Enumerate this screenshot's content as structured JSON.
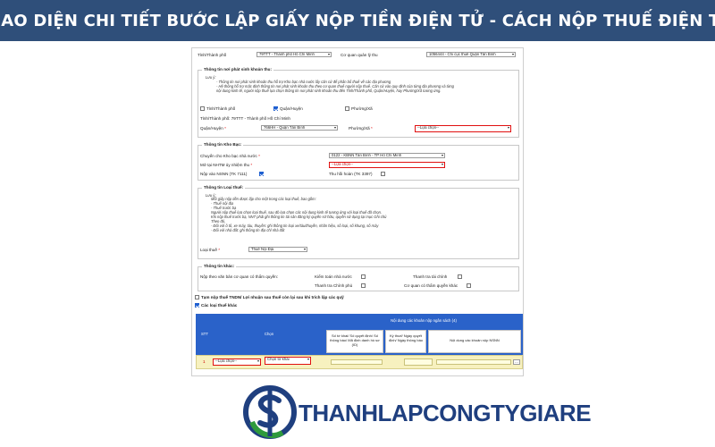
{
  "banner": {
    "title": "GIAO DIỆN CHI TIẾT BƯỚC LẬP GIẤY NỘP TIỀN ĐIỆN TỬ - CÁCH NỘP THUẾ ĐIỆN TỬ"
  },
  "top_row": {
    "province_label": "Tỉnh/Thành phố",
    "province_value": "79TTT - Thành phố Hồ Chí Minh",
    "agency_label": "Cơ quan quản lý thu",
    "agency_value": "1056444 - Chi cục thuế Quận Tân Bình"
  },
  "section_location": {
    "legend": "Thông tin nơi phát sinh khoản thu:",
    "note_title": "Lưu ý:",
    "note_lines": [
      "- Thông tin nơi phát sinh khoản thu hỗ trợ Kho bạc nhà nước lấy căn cứ để phân bổ thuế về các địa phương",
      "- Hệ thống hỗ trợ mặc định thông tin nơi phát sinh khoản thu theo cơ quan thuế người nộp thuế. Căn cứ vào quy định của từng địa phương và từng",
      "nội dung kinh tế, người nộp thuế lựa chọn thông tin nơi phát sinh khoản thu đến Tỉnh/Thành phố, Quận/Huyện, hay Phường/Xã tương ứng."
    ],
    "chk_province": "Tỉnh/Thành phố",
    "chk_district": "Quận/Huyện",
    "chk_ward": "Phường/Xã",
    "province_line": "Tỉnh/Thành phố: 79TTT - Thành phố Hồ Chí Minh",
    "district_label": "Quận/Huyện",
    "district_value": "766HH - Quận Tân Bình",
    "ward_label": "Phường/Xã",
    "ward_value": "--Lựa chọn--"
  },
  "section_treasury": {
    "legend": "Thông tin Kho Bạc:",
    "transfer_label": "Chuyển cho Kho bạc nhà nước",
    "transfer_value": "0122 - KBNN Tân Bình - TP Hồ Chí Minh",
    "bank_label": "Mở tại NHTM ủy nhiệm thu",
    "bank_value": "--Lựa chọn--",
    "nsnn_label": "Nộp vào NSNN (TK 7111)",
    "refund_label": "Thu hồi hoàn (TK 3397)"
  },
  "section_taxtype": {
    "legend": "Thông tin Loại thuế:",
    "note_title": "Lưu ý:",
    "note_lines": [
      "Mỗi giấy nộp tiền được lập cho một trong các loại thuế, bao gồm:",
      "- Thuế nội địa",
      "- Thuế trước bạ",
      "Người nộp thuế lựa chọn loại thuế, sau đó lựa chọn các nội dung kinh tế tương ứng với loại thuế đã chọn.",
      "Khi nộp thuế trước bạ, NNT phải ghi thông tin tài sản đăng ký quyền sở hữu, quyền sử dụng tại mục Ghi chú",
      "Theo đó,",
      "- Đối với ô tô, xe máy, tàu, thuyền: ghi thông tin loại xe/tàu/thuyền, nhãn hiệu, số loại, số khung, số máy",
      "- Đối với nhà đất: ghi thông tin địa chỉ nhà đất"
    ],
    "type_label": "Loại thuế",
    "type_value": "Thuế Nội Địa"
  },
  "section_other": {
    "legend": "Thông tin khác:",
    "c1": "Nộp theo văn bản cơ quan có thẩm quyền:",
    "c2": "Kiểm toán nhà nước",
    "c3": "Thanh tra tài chính",
    "c4": "Thanh tra Chính phủ",
    "c5": "Cơ quan có thẩm quyền khác"
  },
  "options": {
    "temp_tax": "Tạm nộp thuế TNDN/ Lợi nhuận sau thuế còn lại sau khi trích lập các quỹ",
    "other_tax": "Các loại thuế khác"
  },
  "table": {
    "header_stt": "STT",
    "header_chon": "Chọn",
    "header_group": "Nội dung các khoản nộp ngân sách (4)",
    "sub1": "Số tờ khai/ Số quyết định/ Số thông báo/ Mã định danh hồ sơ (ID)",
    "sub2": "Kỳ thuế/ Ngày quyết định/ Ngày thông báo",
    "sub3": "Nội dung các khoản nộp NSNN",
    "row_index": "1",
    "row_sel1": "--Lựa chọn--",
    "row_sel2": "Chọn tờ khai",
    "row_btn": "..."
  },
  "logo": {
    "text": "THANHLAPCONGTYGIARE"
  },
  "colors": {
    "banner": "#2f4f7a",
    "highlight": "#e01010",
    "table_header": "#2a62c9",
    "logo_blue": "#1f3f7f",
    "logo_green": "#2f9a3c"
  }
}
